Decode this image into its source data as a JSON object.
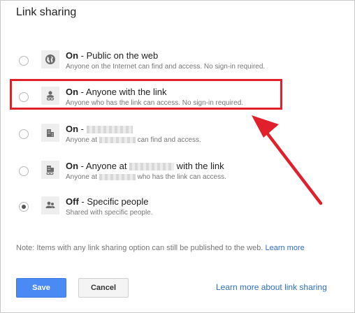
{
  "dialog": {
    "title": "Link sharing",
    "options": [
      {
        "state": "On",
        "label": " - Public on the web",
        "description": "Anyone on the Internet can find and access. No sign-in required.",
        "icon": "globe-icon",
        "checked": false
      },
      {
        "state": "On",
        "label": " - Anyone with the link",
        "description": "Anyone who has the link can access. No sign-in required.",
        "icon": "link-person-icon",
        "checked": false
      },
      {
        "state": "On",
        "label": " - ",
        "description_prefix": "Anyone at ",
        "description_suffix": " can find and access.",
        "icon": "building-icon",
        "checked": false
      },
      {
        "state": "On",
        "label": " - Anyone at ",
        "label_suffix": " with the link",
        "description_prefix": "Anyone at ",
        "description_suffix": " who has the link can access.",
        "icon": "building-link-icon",
        "checked": false
      },
      {
        "state": "Off",
        "label": " - Specific people",
        "description": "Shared with specific people.",
        "icon": "people-icon",
        "checked": true
      }
    ],
    "note": "Note: Items with any link sharing option can still be published to the web. ",
    "note_link": "Learn more",
    "save_label": "Save",
    "cancel_label": "Cancel",
    "learn_more_label": "Learn more about link sharing"
  },
  "colors": {
    "accent": "#4a8af4",
    "link": "#2d6fc3",
    "annotation_red": "#e0202a"
  }
}
